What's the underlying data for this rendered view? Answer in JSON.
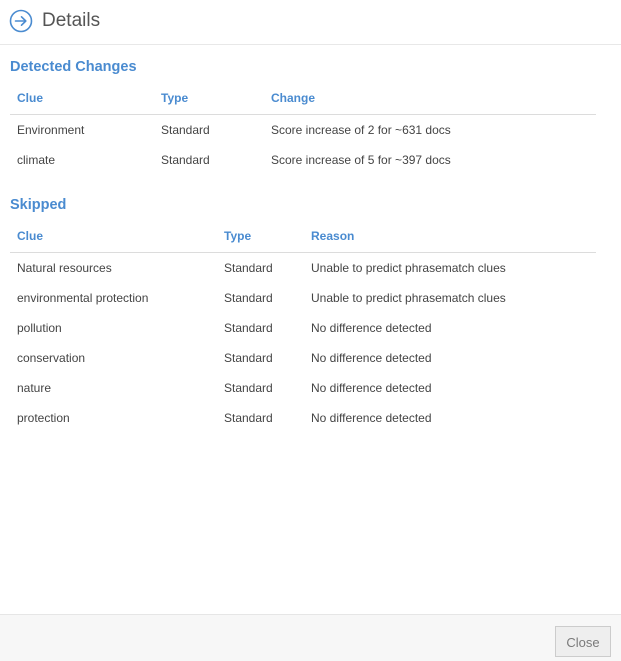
{
  "dialog": {
    "title": "Details",
    "close_label": "Close"
  },
  "detected": {
    "title": "Detected Changes",
    "headers": {
      "clue": "Clue",
      "type": "Type",
      "change": "Change"
    },
    "rows": [
      {
        "clue": "Environment",
        "type": "Standard",
        "change": "Score increase of 2 for ~631 docs"
      },
      {
        "clue": "climate",
        "type": "Standard",
        "change": "Score increase of 5 for ~397 docs"
      }
    ]
  },
  "skipped": {
    "title": "Skipped",
    "headers": {
      "clue": "Clue",
      "type": "Type",
      "reason": "Reason"
    },
    "rows": [
      {
        "clue": "Natural resources",
        "type": "Standard",
        "reason": "Unable to predict phrasematch clues"
      },
      {
        "clue": "environmental protection",
        "type": "Standard",
        "reason": "Unable to predict phrasematch clues"
      },
      {
        "clue": "pollution",
        "type": "Standard",
        "reason": "No difference detected"
      },
      {
        "clue": "conservation",
        "type": "Standard",
        "reason": "No difference detected"
      },
      {
        "clue": "nature",
        "type": "Standard",
        "reason": "No difference detected"
      },
      {
        "clue": "protection",
        "type": "Standard",
        "reason": "No difference detected"
      }
    ]
  },
  "colors": {
    "accent": "#4a8bd0",
    "text": "#444444"
  },
  "icons": {
    "header": "arrow-right-circle-icon"
  }
}
